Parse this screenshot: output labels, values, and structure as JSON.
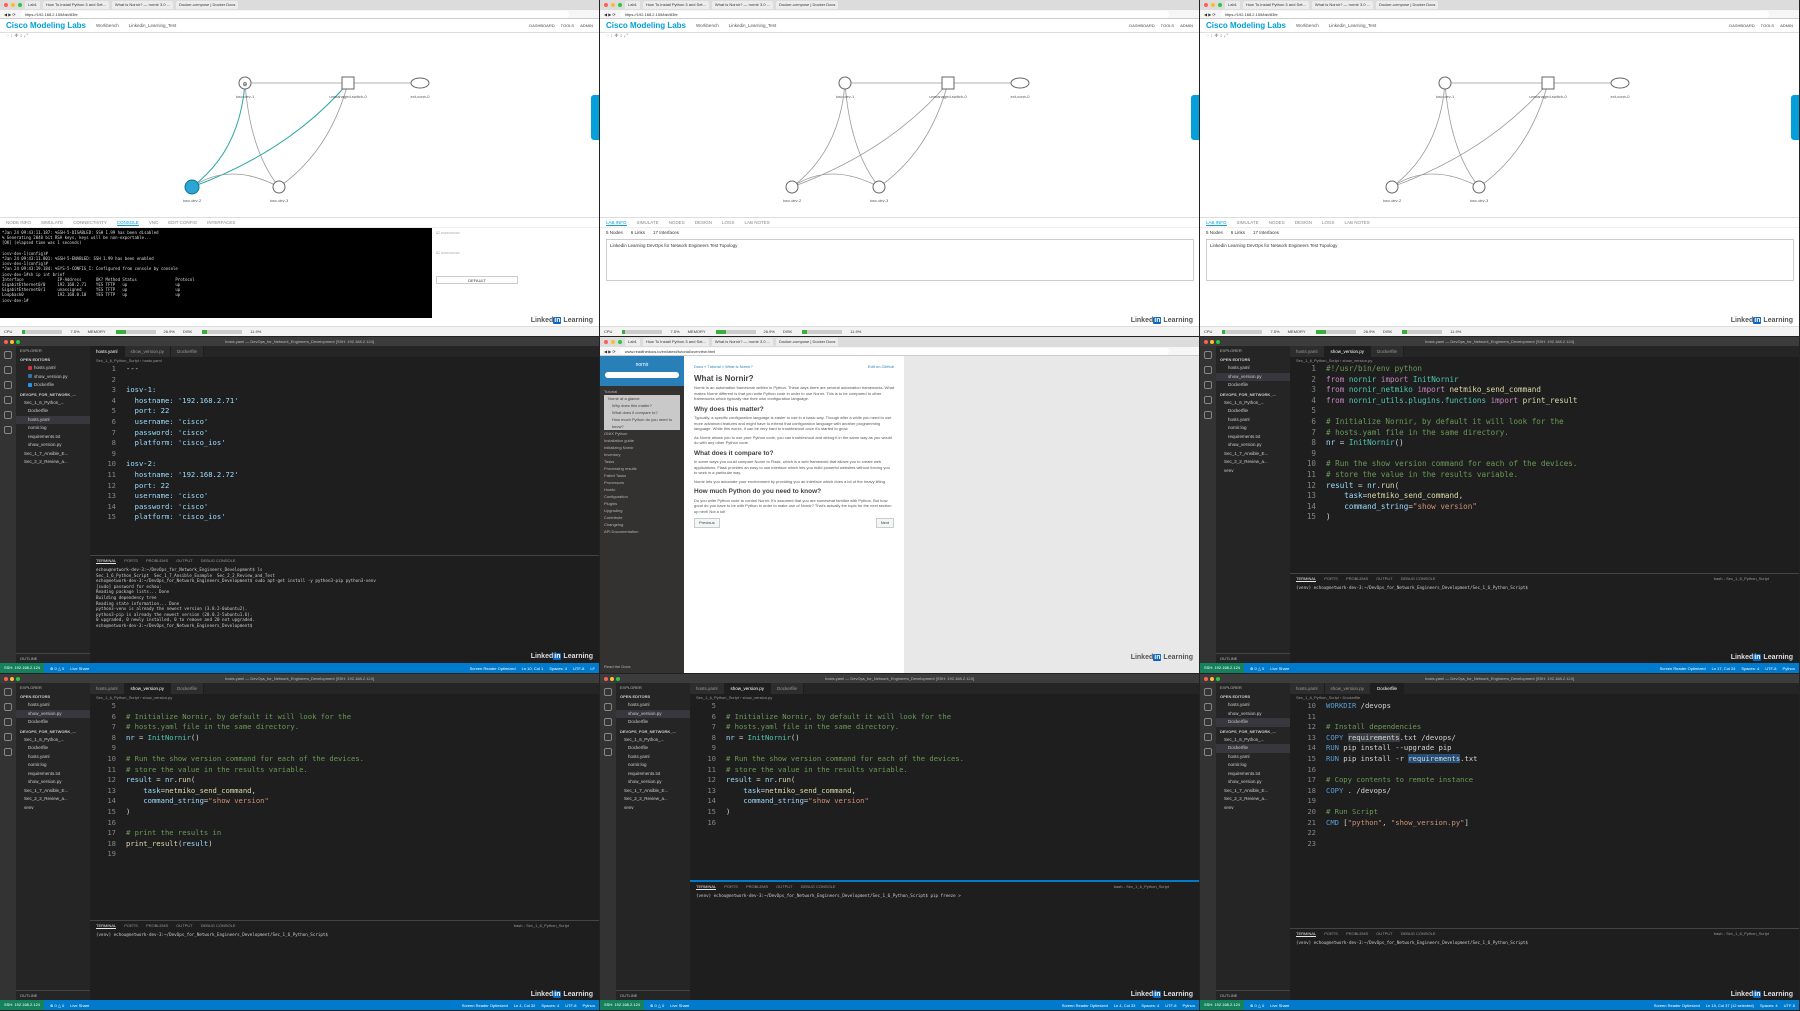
{
  "cml": {
    "logo": "Cisco Modeling Labs",
    "crumb_workbench": "Workbench",
    "crumb_lab": "Linkedin_Learning_Test",
    "actions": [
      "DASHBOARD",
      "TOOLS",
      "ADMIN"
    ],
    "url": "https://192.168.2.155/lab/83fe",
    "tabs": [
      "Lab1",
      "How To Install Python 3 and Set...",
      "What is Nornir? — nornir 3.0 ...",
      "Docker-compose | Docker Docs"
    ],
    "nodes": [
      "iosv-dev-1",
      "iosv-dev-2",
      "iosv-dev-3",
      "ext-conn-0",
      "unmanaged-switch-0"
    ],
    "console_tabs": [
      "NODE INFO",
      "SIMULATE",
      "CONNECTIVITY",
      "CONSOLE",
      "VNC",
      "EDIT CONFIG",
      "INTERFACES"
    ],
    "lab_tabs": [
      "LAB INFO",
      "SIMULATE",
      "NODES",
      "DESIGN",
      "LOGS",
      "LAB NOTES"
    ],
    "summary": [
      "5 Nodes",
      "6 Links",
      "17 Interfaces"
    ],
    "description": "Linkedin Learning DevOps for Network Engineers Test Topology",
    "console_text": "*Jan 24 09:43:11.187: %SSH-5-DISABLED: SSH 1.99 has been disabled\n% Generating 2048 bit RSA keys, keys will be non-exportable...\n[OK] (elapsed time was 1 seconds)\n\niosv-dev-1(config)#\n*Jan 24 09:43:11.801: %SSH-5-ENABLED: SSH 1.99 has been enabled\niosv-dev-1(config)#\n*Jan 24 09:43:19.184: %SYS-5-CONFIG_I: Configured from console by console\niosv-dev-1#sh ip int brief\nInterface              IP-Address      OK? Method Status                Protocol\nGigabitEthernet0/0     192.168.2.71    YES TFTP   up                    up\nGigabitEthernet0/1     unassigned      YES TFTP   up                    up\nLoopback0              192.168.0.10    YES TFTP   up                    up\niosv-dev-1#",
    "default_button": "DEFAULT",
    "status": {
      "cpu_label": "CPU",
      "cpu": 7.5,
      "mem_label": "MEMORY",
      "mem": 26.9,
      "disk_label": "DISK",
      "disk": 11.9,
      "cpu_text": "7.5%",
      "mem_text": "26.9%",
      "disk_text": "11.9%"
    }
  },
  "watermark": {
    "left": "Linked",
    "box": "in",
    "right": " Learning"
  },
  "vscode": {
    "title": "hosts.yaml — DevOps_for_Network_Engineers_Development [SSH: 192.168.2.124]",
    "explorer": "EXPLORER",
    "open_editors": "OPEN EDITORS",
    "workspace": "DEVOPS_FOR_NETWORK_...",
    "files": [
      "hosts.yaml",
      "show_version.py",
      "Dockerfile"
    ],
    "tree": [
      "Sec_1_6_Python_...",
      "Dockerfile",
      "hosts.yaml",
      "nornir.log",
      "requirements.txt",
      "show_version.py",
      "Sec_1_7_Ansible_E...",
      "Sec_2_2_Review_a...",
      "venv"
    ],
    "outline": "OUTLINE",
    "crumb_hosts": "Sec_1_6_Python_Script  ›  hosts.yaml",
    "crumb_show": "Sec_1_6_Python_Script  ›  show_version.py",
    "crumb_docker": "Sec_1_6_Python_Script  ›  Dockerfile",
    "term_tabs": [
      "TERMINAL",
      "PORTS",
      "PROBLEMS",
      "OUTPUT",
      "DEBUG CONSOLE"
    ],
    "term_right": "bash - Sec_1_6_Python_Script",
    "term_apt": "echou@network-dev-3:~/DevOps_for_Network_Engineers_Development$ ls\nSec_1_6_Python_Script  Sec_1_7_Ansible_Example  Sec_2_2_Review_and_Test\necho@network-dev-3:~/DevOps_for_Network_Engineers_Development$ sudo apt-get install -y python3-pip python3-venv\n[sudo] password for echou:\nReading package lists... Done\nBuilding dependency tree\nReading state information... Done\npython3-venv is already the newest version (3.8.2-0ubuntu2).\npython3-pip is already the newest version (20.0.2-5ubuntu1.6).\n0 upgraded, 0 newly installed, 0 to remove and 20 not upgraded.\necho@network-dev-3:~/DevOps_for_Network_Engineers_Development$",
    "term_prompt": "(venv) echou@network-dev-3:~/DevOps_for_Network_Engineers_Development/Sec_1_6_Python_Script$",
    "term_pip": "(venv) echou@network-dev-3:~/DevOps_for_Network_Engineers_Development/Sec_1_6_Python_Script$ pip freeze >",
    "status_remote": "SSH: 192.168.2.124",
    "status_items": [
      "⊗ 0 △ 0",
      "Live Share"
    ],
    "status_right": [
      "Screen Reader Optimized",
      "Spaces: 4",
      "UTF-8",
      "LF",
      "Python"
    ],
    "status_pos": [
      "Ln 10, Col 1",
      "Ln 17, Col 24",
      "Ln 4, Col 32",
      "Ln 4, Col 33",
      "Ln 15, Col 37 (12 selected)"
    ]
  },
  "docs": {
    "brand": "nornir",
    "nav": [
      "Tutorial",
      "Nornir at a glance",
      "Why does this matter?",
      "What does it compare to?",
      "How much Python do you need to know?",
      "ONIX Python",
      "Installation guide",
      "Initializing Nornir",
      "Inventory",
      "Tasks",
      "Processing results",
      "Failed Tasks",
      "Processors",
      "Howto",
      "Configuration",
      "Plugins",
      "Upgrading",
      "Contribute",
      "Changelog",
      "API Documentation"
    ],
    "crumb": "Docs » Tutorial » What is Nornir?",
    "edit": "Edit on GitHub",
    "h1": "What is Nornir?",
    "p1": "Nornir is an automation framework written in Python. These days there are several automation frameworks. What makes Nornir different is that you write Python code in order to use Nornir. This is to be compared to other frameworks which typically use their own configuration language.",
    "h2a": "Why does this matter?",
    "p2": "Typically, a specific configuration language is easier to use in a basic way. Though after a while you need to use more advanced features and might have to extend that configuration language with another programming language. While this works, it can be very hard to troubleshoot once it's started to grow.",
    "p3": "As Nornir allows you to use pure Python code, you can troubleshoot and debug it in the same way as you would do with any other Python code.",
    "h2b": "What does it compare to?",
    "p4": "In some ways you could compare Nornir to Flask, which is a web framework that allows you to create web applications. Flask provides an easy to use interface which lets you build powerful websites without forcing you to work in a particular way.",
    "p5": "Nornir lets you automate your environment by providing you an interface which does a lot of the heavy lifting.",
    "h2c": "How much Python do you need to know?",
    "p6": "Do you write Python code to control Nornir. It's assumed that you are somewhat familiar with Python. But how good do you have to be with Python in order to make use of Nornir? That's actually the topic for the next section up next! Not a lot!",
    "prev": "Previous",
    "next": "Next",
    "url": "www.readthedocs.io/en/latest/tutorial/overview.html",
    "footer": "Read the Docs"
  },
  "code": {
    "hosts": [
      "---",
      "",
      "iosv-1:",
      "  hostname: '192.168.2.71'",
      "  port: 22",
      "  username: 'cisco'",
      "  password: 'cisco'",
      "  platform: 'cisco_ios'",
      "",
      "iosv-2:",
      "  hostname: '192.168.2.72'",
      "  port: 22",
      "  username: 'cisco'",
      "  password: 'cisco'",
      "  platform: 'cisco_ios'"
    ]
  }
}
